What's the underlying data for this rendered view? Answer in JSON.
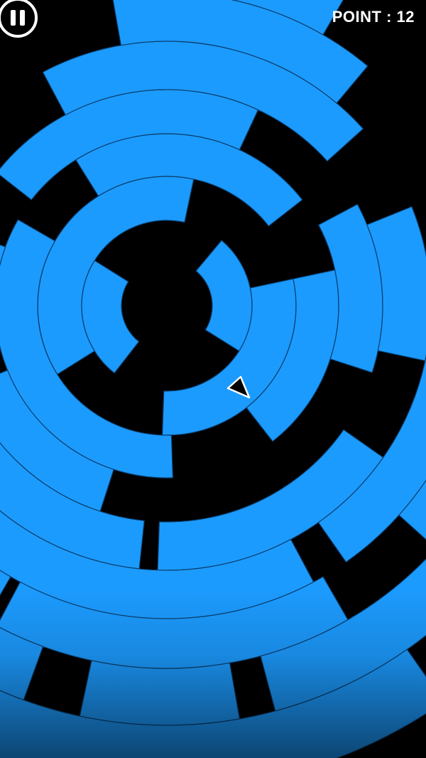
{
  "hud": {
    "score_label": "POINT : 12",
    "pause_icon": "pause-icon"
  },
  "colors": {
    "ring": "#1c9bff",
    "background": "#000000",
    "ring_outline": "#0a3f6e",
    "player_fill": "#000000",
    "player_stroke": "#ffffff"
  }
}
